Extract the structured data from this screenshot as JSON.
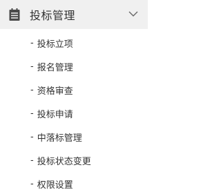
{
  "menu": {
    "title": "投标管理",
    "icon": "document-icon",
    "expand_icon": "chevron-down-icon",
    "items": [
      {
        "prefix": "-",
        "label": "投标立项"
      },
      {
        "prefix": "-",
        "label": "报名管理"
      },
      {
        "prefix": "-",
        "label": "资格审查"
      },
      {
        "prefix": "-",
        "label": "投标申请"
      },
      {
        "prefix": "-",
        "label": "中落标管理"
      },
      {
        "prefix": "-",
        "label": "投标状态变更"
      },
      {
        "prefix": "-",
        "label": "权限设置"
      }
    ]
  },
  "colors": {
    "header_bg": "#f0f0f0",
    "text": "#333333",
    "icon": "#4a4a4a",
    "chevron": "#666666",
    "background": "#ffffff"
  }
}
